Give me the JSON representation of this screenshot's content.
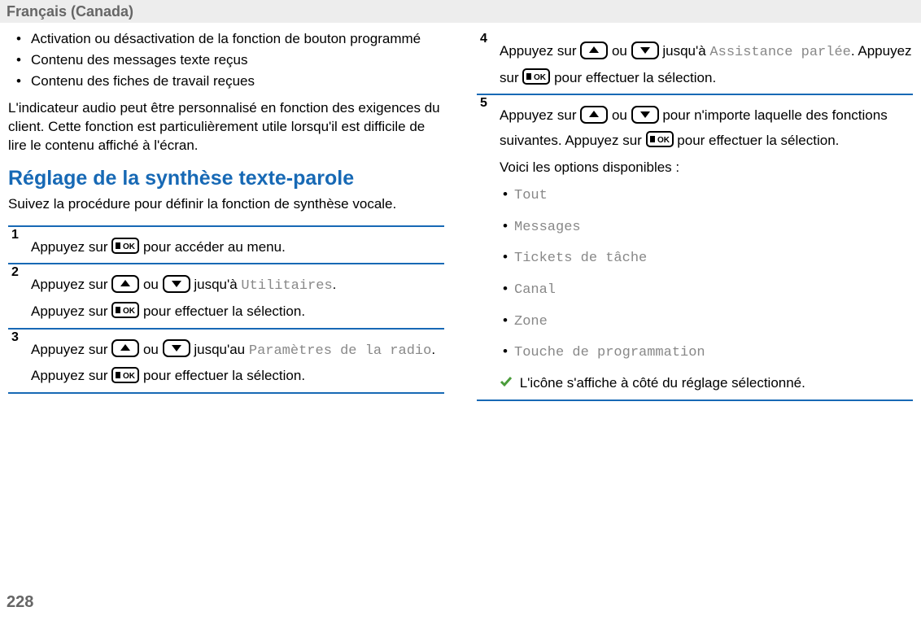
{
  "header": {
    "language": "Français (Canada)"
  },
  "page_number": "228",
  "left": {
    "bullets": [
      "Activation ou désactivation de la fonction de bouton programmé",
      "Contenu des messages texte reçus",
      "Contenu des fiches de travail reçues"
    ],
    "para": "L'indicateur audio peut être personnalisé en fonction des exigences du client. Cette fonction est particulièrement utile lorsqu'il est difficile de lire le contenu affiché à l'écran.",
    "section_title": "Réglage de la synthèse texte-parole",
    "section_intro": "Suivez la procédure pour définir la fonction de synthèse vocale."
  },
  "steps": {
    "s1": {
      "num": "1",
      "a": "Appuyez sur ",
      "b": " pour accéder au menu."
    },
    "s2": {
      "num": "2",
      "a": "Appuyez sur ",
      "ou": " ou ",
      "b": " jusqu'à ",
      "target": "Utilitaires",
      "c": ".",
      "d": "Appuyez sur ",
      "e": " pour effectuer la sélection."
    },
    "s3": {
      "num": "3",
      "a": "Appuyez sur ",
      "ou": " ou ",
      "b": " jusqu'au ",
      "target": "Paramètres de la radio",
      "c": ". Appuyez sur ",
      "d": " pour effectuer la sélection."
    },
    "s4": {
      "num": "4",
      "a": "Appuyez sur ",
      "ou": " ou ",
      "b": " jusqu'à ",
      "target": "Assistance parlée",
      "c": ". Appuyez sur ",
      "d": " pour effectuer la sélection."
    },
    "s5": {
      "num": "5",
      "a": "Appuyez sur ",
      "ou": " ou ",
      "b": " pour n'importe laquelle des fonctions suivantes. Appuyez sur ",
      "c": " pour effectuer la sélection.",
      "opts_intro": "Voici les options disponibles :",
      "opts": [
        "Tout",
        "Messages",
        "Tickets de tâche",
        "Canal",
        "Zone",
        "Touche de programmation"
      ],
      "result": " L'icône s'affiche à côté du réglage sélectionné."
    }
  }
}
